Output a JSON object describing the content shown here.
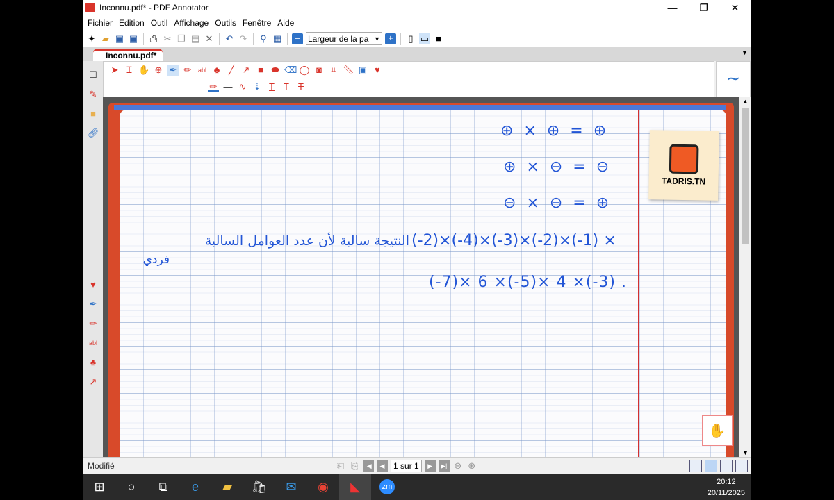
{
  "window": {
    "title": "Inconnu.pdf* - PDF Annotator",
    "controls": [
      "—",
      "❐",
      "✕"
    ]
  },
  "menu": [
    "Fichier",
    "Edition",
    "Outil",
    "Affichage",
    "Outils",
    "Fenêtre",
    "Aide"
  ],
  "toolbar": {
    "zoom_select": "Largeur de la pa"
  },
  "tab": {
    "label": "Inconnu.pdf*"
  },
  "document": {
    "rules": [
      "⊕ × ⊕ = ⊕",
      "⊕ × ⊖ = ⊖",
      "⊖ × ⊖ = ⊕"
    ],
    "arabic_line1": "النتيجة سالبة لأن عدد العوامل السالبة",
    "arabic_line2": "فردي",
    "expr_line1": "(-2)×(-4)×(-3)×(-2)×(-1) ×",
    "expr_line2": "(-7)× 6 ×(-5)× 4 ×(-3) .",
    "sticky_label": "TADRIS.TN",
    "accent": "#2255d6"
  },
  "status": {
    "text": "Modifié",
    "page": "1 sur 1"
  },
  "taskbar": {
    "time": "20:12",
    "date": "20/11/2025"
  }
}
